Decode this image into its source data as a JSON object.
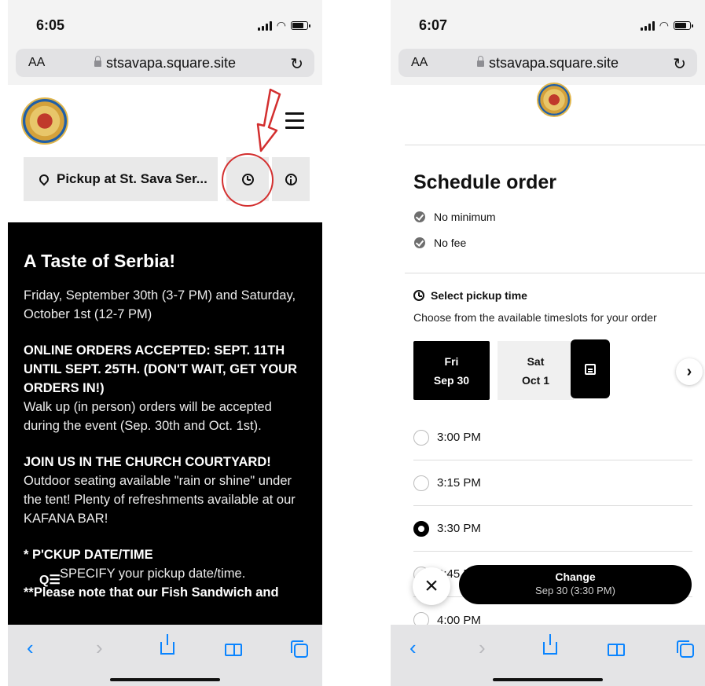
{
  "colors": {
    "accent": "#0a84ff",
    "annotation": "#d32f2f",
    "dark": "#000000"
  },
  "left": {
    "status_time": "6:05",
    "url_aa": "AA",
    "url": "stsavapa.square.site",
    "pickup_label": "Pickup at St. Sava Ser...",
    "content": {
      "heading": "A Taste of Serbia!",
      "p1": "Friday, September 30th (3-7 PM) and Saturday, October 1st (12-7 PM)",
      "p2_bold": "ONLINE ORDERS ACCEPTED: SEPT. 11TH UNTIL SEPT. 25TH. (DON'T WAIT, GET YOUR ORDERS IN!)",
      "p2_text": "Walk up (in person) orders will be accepted during the event (Sep. 30th and Oct. 1st).",
      "p3_bold": "JOIN US IN THE CHURCH COURTYARD!",
      "p3_text": "Outdoor seating available \"rain or shine\" under the tent! Plenty of refreshments available at our KAFANA BAR!",
      "p4_bold": "* P'CKUP DATE/TIME",
      "p4_text": "SPECIFY your pickup date/time.",
      "p5_bold": "**Please note that our Fish Sandwich and"
    }
  },
  "right": {
    "status_time": "6:07",
    "url_aa": "AA",
    "url": "stsavapa.square.site",
    "title": "Schedule order",
    "checks": [
      "No minimum",
      "No fee"
    ],
    "select_label": "Select pickup time",
    "select_sub": "Choose from the available timeslots for your order",
    "dates": [
      {
        "day": "Fri",
        "date": "Sep 30",
        "active": true
      },
      {
        "day": "Sat",
        "date": "Oct 1",
        "active": false
      }
    ],
    "times": [
      {
        "label": "3:00 PM",
        "selected": false
      },
      {
        "label": "3:15 PM",
        "selected": false
      },
      {
        "label": "3:30 PM",
        "selected": true
      },
      {
        "label": "3:45 PM",
        "selected": false
      },
      {
        "label": "4:00 PM",
        "selected": false
      }
    ],
    "change_label": "Change",
    "change_sub": "Sep 30 (3:30 PM)"
  }
}
